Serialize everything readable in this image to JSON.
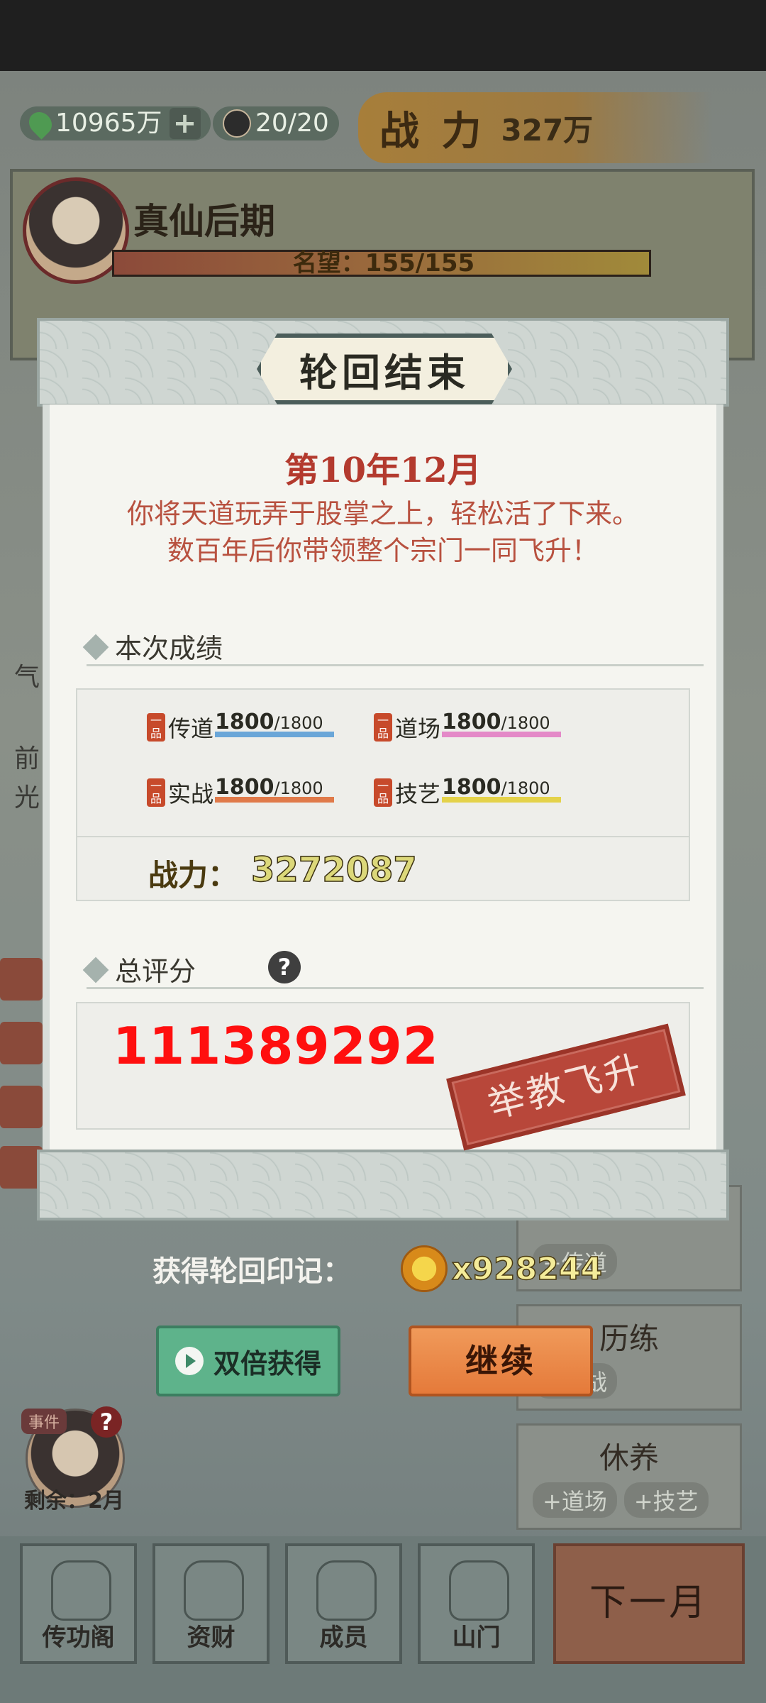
{
  "hud": {
    "spirit_stones": "10965万",
    "disciples": "20/20",
    "power_label": "战 力",
    "power_value": "327万"
  },
  "character": {
    "realm": "真仙后期",
    "fame_label": "名望：155/155",
    "fame_ratio": 1.0
  },
  "side_log": {
    "items": [
      "气",
      "前",
      "光"
    ]
  },
  "action_cards": [
    {
      "title": "",
      "chips": [
        "+传道"
      ]
    },
    {
      "title": "历练",
      "chips": [
        "+实战"
      ]
    },
    {
      "title": "休养",
      "chips": [
        "+道场",
        "+技艺"
      ]
    }
  ],
  "event": {
    "tag": "事件",
    "remaining": "剩余：2月"
  },
  "bottom_nav": {
    "items": [
      "传功阁",
      "资财",
      "成员",
      "山门"
    ],
    "next_month": "下一月"
  },
  "modal": {
    "title": "轮回结束",
    "date": "第10年12月",
    "story_line1": "你将天道玩弄于股掌之上，轻松活了下来。",
    "story_line2": "数百年后你带领整个宗门一同飞升！",
    "section_scores": "本次成绩",
    "scores": [
      {
        "grade": "一品",
        "name": "传道",
        "value": "1800",
        "max": "1800",
        "color": "#6aa6d8"
      },
      {
        "grade": "一品",
        "name": "道场",
        "value": "1800",
        "max": "1800",
        "color": "#e489c8"
      },
      {
        "grade": "一品",
        "name": "实战",
        "value": "1800",
        "max": "1800",
        "color": "#e07a4a"
      },
      {
        "grade": "一品",
        "name": "技艺",
        "value": "1800",
        "max": "1800",
        "color": "#e4d24a"
      }
    ],
    "power_label": "战力：",
    "power_value": "3272087",
    "section_total": "总评分",
    "help": "?",
    "total_score": "111389292",
    "stamp": "举教飞升"
  },
  "reward": {
    "label": "获得轮回印记：",
    "quantity": "x928244"
  },
  "buttons": {
    "double": "双倍获得",
    "continue": "继续"
  }
}
